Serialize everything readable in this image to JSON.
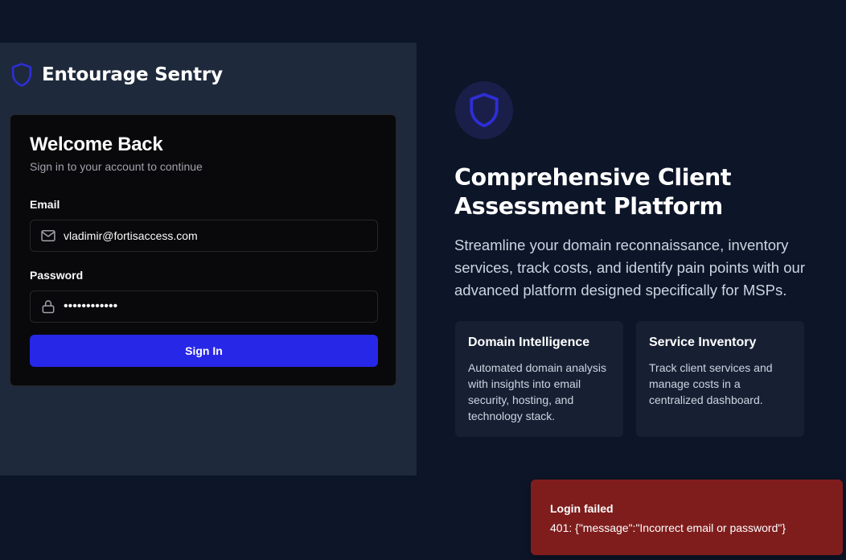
{
  "brand": {
    "name": "Entourage Sentry",
    "icon": "shield-icon",
    "accent_color": "#2727e8"
  },
  "login": {
    "title": "Welcome Back",
    "subtitle": "Sign in to your account to continue",
    "email": {
      "label": "Email",
      "value": "vladimir@fortisaccess.com",
      "icon": "mail-icon"
    },
    "password": {
      "label": "Password",
      "value": "••••••••••••",
      "icon": "lock-icon"
    },
    "submit_label": "Sign In"
  },
  "hero": {
    "icon": "shield-icon",
    "title": "Comprehensive Client Assessment Platform",
    "description": "Streamline your domain reconnaissance, inventory services, track costs, and identify pain points with our advanced platform designed specifically for MSPs."
  },
  "features": [
    {
      "title": "Domain Intelligence",
      "description": "Automated domain analysis with insights into email security, hosting, and technology stack."
    },
    {
      "title": "Service Inventory",
      "description": "Track client services and manage costs in a centralized dashboard."
    }
  ],
  "toast": {
    "title": "Login failed",
    "message": "401: {\"message\":\"Incorrect email or password\"}",
    "color": "#7f1d1d"
  }
}
